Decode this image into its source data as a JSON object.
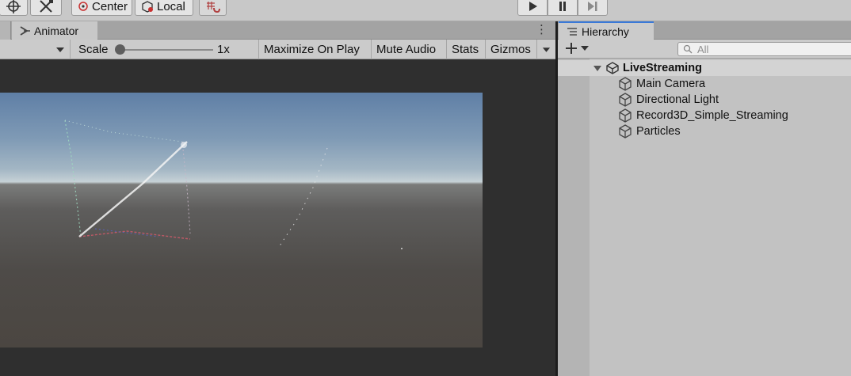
{
  "toolbar": {
    "center_label": "Center",
    "local_label": "Local",
    "icons": [
      "move-tool-icon",
      "transform-tool-icon",
      "pivot-center-icon",
      "pivot-local-icon",
      "grid-snap-icon",
      "play-icon",
      "pause-icon",
      "step-icon"
    ]
  },
  "game_view": {
    "tab_label": "Animator",
    "scale_label": "Scale",
    "scale_value": "1x",
    "scale_fraction": 0.0,
    "maximize_label": "Maximize On Play",
    "mute_label": "Mute Audio",
    "stats_label": "Stats",
    "gizmos_label": "Gizmos"
  },
  "hierarchy": {
    "tab_label": "Hierarchy",
    "search_placeholder": "All",
    "scene_name": "LiveStreaming",
    "items": [
      {
        "label": "Main Camera"
      },
      {
        "label": "Directional Light"
      },
      {
        "label": "Record3D_Simple_Streaming"
      },
      {
        "label": "Particles"
      }
    ]
  },
  "colors": {
    "accent": "#3a79d8",
    "panel_bg": "#c2c2c2",
    "game_bg": "#2f2f2f"
  }
}
